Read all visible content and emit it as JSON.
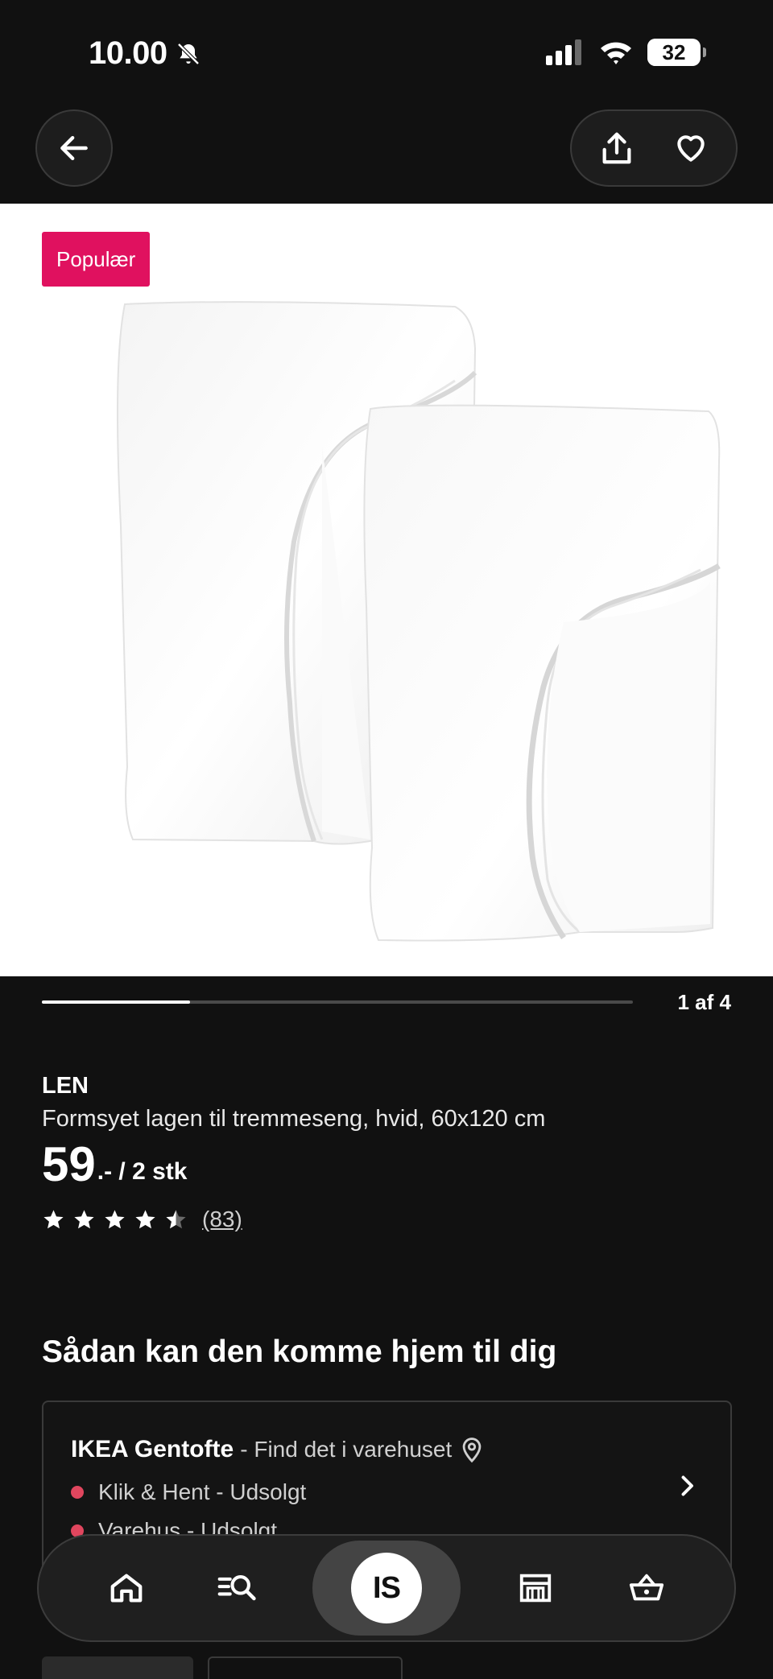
{
  "status_bar": {
    "time": "10.00",
    "battery": "32"
  },
  "product": {
    "badge": "Populær",
    "brand": "LEN",
    "description": "Formsyet lagen til tremmeseng, hvid, 60x120 cm",
    "price_value": "59",
    "price_suffix": ".- / 2 stk",
    "rating": 4.5,
    "review_count": "(83)",
    "image_counter": "1 af 4",
    "image_progress_fraction": 0.25
  },
  "delivery": {
    "title": "Sådan kan den komme hjem til dig",
    "store_name": "IKEA Gentofte",
    "store_sub": " - Find det i varehuset",
    "stock": [
      {
        "label": "Klik & Hent - Udsolgt",
        "color": "#e0465e"
      },
      {
        "label": "Varehus - Udsolgt",
        "color": "#e0465e"
      }
    ]
  },
  "bottom_nav": {
    "items": [
      "home-icon",
      "search-icon",
      "profile",
      "store-icon",
      "basket-icon"
    ],
    "profile_initials": "IS"
  },
  "colors": {
    "accent": "#e0115f",
    "background": "#111111"
  }
}
